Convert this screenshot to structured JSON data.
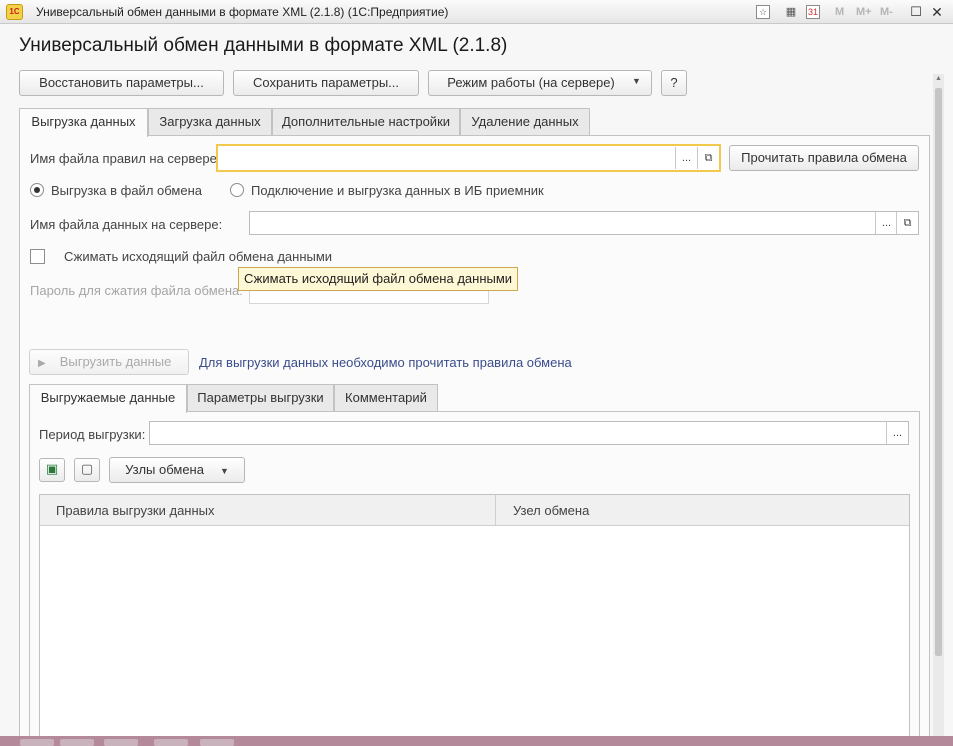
{
  "window": {
    "logo_text": "1C",
    "title": "Универсальный обмен данными в формате XML (2.1.8)  (1С:Предприятие)",
    "toolbar": {
      "calendar_day": "31",
      "m": "M",
      "m_plus": "M+",
      "m_minus": "M-"
    }
  },
  "form": {
    "title": "Универсальный обмен данными в формате XML (2.1.8)",
    "buttons": {
      "restore": "Восстановить параметры...",
      "save": "Сохранить параметры...",
      "mode": "Режим работы (на сервере)",
      "help": "?"
    },
    "tabs": [
      "Выгрузка данных",
      "Загрузка данных",
      "Дополнительные настройки",
      "Удаление данных"
    ],
    "export": {
      "rules_file_label": "Имя файла правил на сервере:",
      "rules_file_value": "",
      "read_rules_button": "Прочитать правила обмена",
      "choose_button": "...",
      "radio_file": "Выгрузка в файл обмена",
      "radio_db": "Подключение и выгрузка данных в ИБ приемник",
      "data_file_label": "Имя файла данных на сервере:",
      "data_file_value": "",
      "compress_label": "Сжимать исходящий файл обмена данными",
      "compress_tooltip": "Сжимать исходящий файл обмена данными",
      "password_label": "Пароль для сжатия файла обмена:",
      "export_button": "Выгрузить данные",
      "hint": "Для выгрузки данных необходимо прочитать правила обмена"
    },
    "subtabs": [
      "Выгружаемые данные",
      "Параметры выгрузки",
      "Комментарий"
    ],
    "period_label": "Период выгрузки:",
    "period_value": "",
    "nodes_button": "Узлы обмена",
    "grid": {
      "columns": [
        "Правила выгрузки данных",
        "Узел обмена"
      ],
      "rows": []
    }
  },
  "colors": {
    "focus": "#f2c94c",
    "link": "#3a4d8c",
    "tooltip_bg": "#fff8d6"
  }
}
